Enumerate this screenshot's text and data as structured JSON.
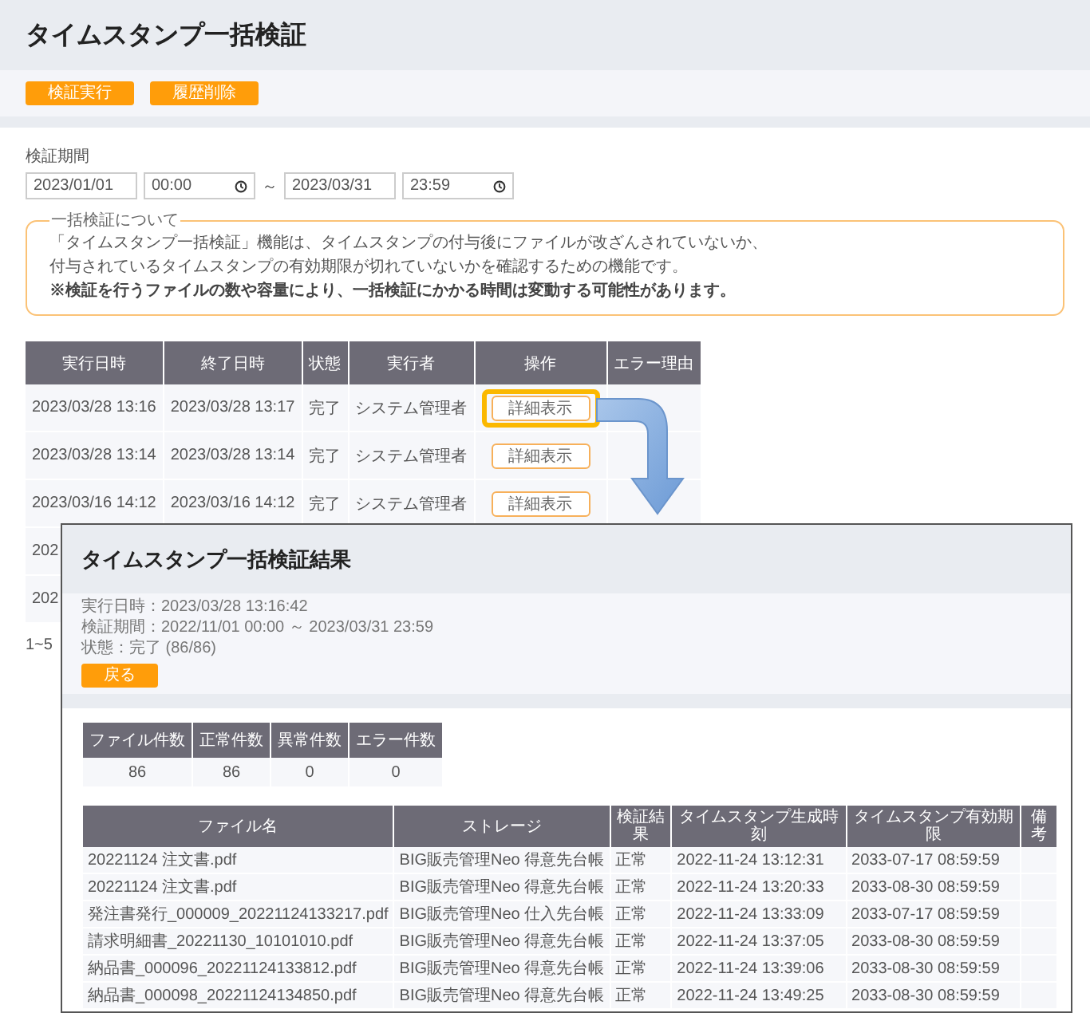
{
  "page": {
    "title": "タイムスタンプ一括検証"
  },
  "toolbar": {
    "buttons": [
      "検証実行",
      "履歴削除"
    ]
  },
  "period": {
    "label": "検証期間",
    "start_date": "2023/01/01",
    "start_time": "00:00",
    "separator": "～",
    "end_date": "2023/03/31",
    "end_time": "23:59"
  },
  "about": {
    "legend": "一括検証について",
    "lines": [
      {
        "text": "「タイムスタンプ一括検証」機能は、タイムスタンプの付与後にファイルが改ざんされていないか、",
        "bold": false
      },
      {
        "text": "付与されているタイムスタンプの有効期限が切れていないかを確認するための機能です。",
        "bold": false
      },
      {
        "text": "※検証を行うファイルの数や容量により、一括検証にかかる時間は変動する可能性があります。",
        "bold": true
      }
    ]
  },
  "history": {
    "columns": [
      "実行日時",
      "終了日時",
      "状態",
      "実行者",
      "操作",
      "エラー理由"
    ],
    "rows": [
      {
        "start": "2023/03/28 13:16",
        "end": "2023/03/28 13:17",
        "status": "完了",
        "user": "システム管理者",
        "action": "詳細表示",
        "highlighted": true
      },
      {
        "start": "2023/03/28 13:14",
        "end": "2023/03/28 13:14",
        "status": "完了",
        "user": "システム管理者",
        "action": "詳細表示",
        "highlighted": false
      },
      {
        "start": "2023/03/16 14:12",
        "end": "2023/03/16 14:12",
        "status": "完了",
        "user": "システム管理者",
        "action": "詳細表示",
        "highlighted": false
      },
      {
        "start": "202"
      },
      {
        "start": "202"
      }
    ],
    "count": "1~5"
  },
  "result_window": {
    "title": "タイムスタンプ一括検証結果",
    "info": [
      "実行日時：2023/03/28 13:16:42",
      "検証期間：2022/11/01 00:00 ～ 2023/03/31 23:59",
      "状態：完了 (86/86)"
    ],
    "back_button": "戻る",
    "summary": {
      "columns": [
        "ファイル件数",
        "正常件数",
        "異常件数",
        "エラー件数"
      ],
      "values": [
        "86",
        "86",
        "0",
        "0"
      ]
    },
    "files": {
      "columns": [
        "ファイル名",
        "ストレージ",
        "検証結果",
        "タイムスタンプ生成時刻",
        "タイムスタンプ有効期限",
        "備考"
      ],
      "rows": [
        [
          "20221124 注文書.pdf",
          "BIG販売管理Neo 得意先台帳",
          "正常",
          "2022-11-24 13:12:31",
          "2033-07-17 08:59:59"
        ],
        [
          "20221124 注文書.pdf",
          "BIG販売管理Neo 得意先台帳",
          "正常",
          "2022-11-24 13:20:33",
          "2033-08-30 08:59:59"
        ],
        [
          "発注書発行_000009_20221124133217.pdf",
          "BIG販売管理Neo 仕入先台帳",
          "正常",
          "2022-11-24 13:33:09",
          "2033-07-17 08:59:59"
        ],
        [
          "請求明細書_20221130_10101010.pdf",
          "BIG販売管理Neo 得意先台帳",
          "正常",
          "2022-11-24 13:37:05",
          "2033-08-30 08:59:59"
        ],
        [
          "納品書_000096_20221124133812.pdf",
          "BIG販売管理Neo 得意先台帳",
          "正常",
          "2022-11-24 13:39:06",
          "2033-08-30 08:59:59"
        ],
        [
          "納品書_000098_20221124134850.pdf",
          "BIG販売管理Neo 得意先台帳",
          "正常",
          "2022-11-24 13:49:25",
          "2033-08-30 08:59:59"
        ]
      ]
    }
  }
}
